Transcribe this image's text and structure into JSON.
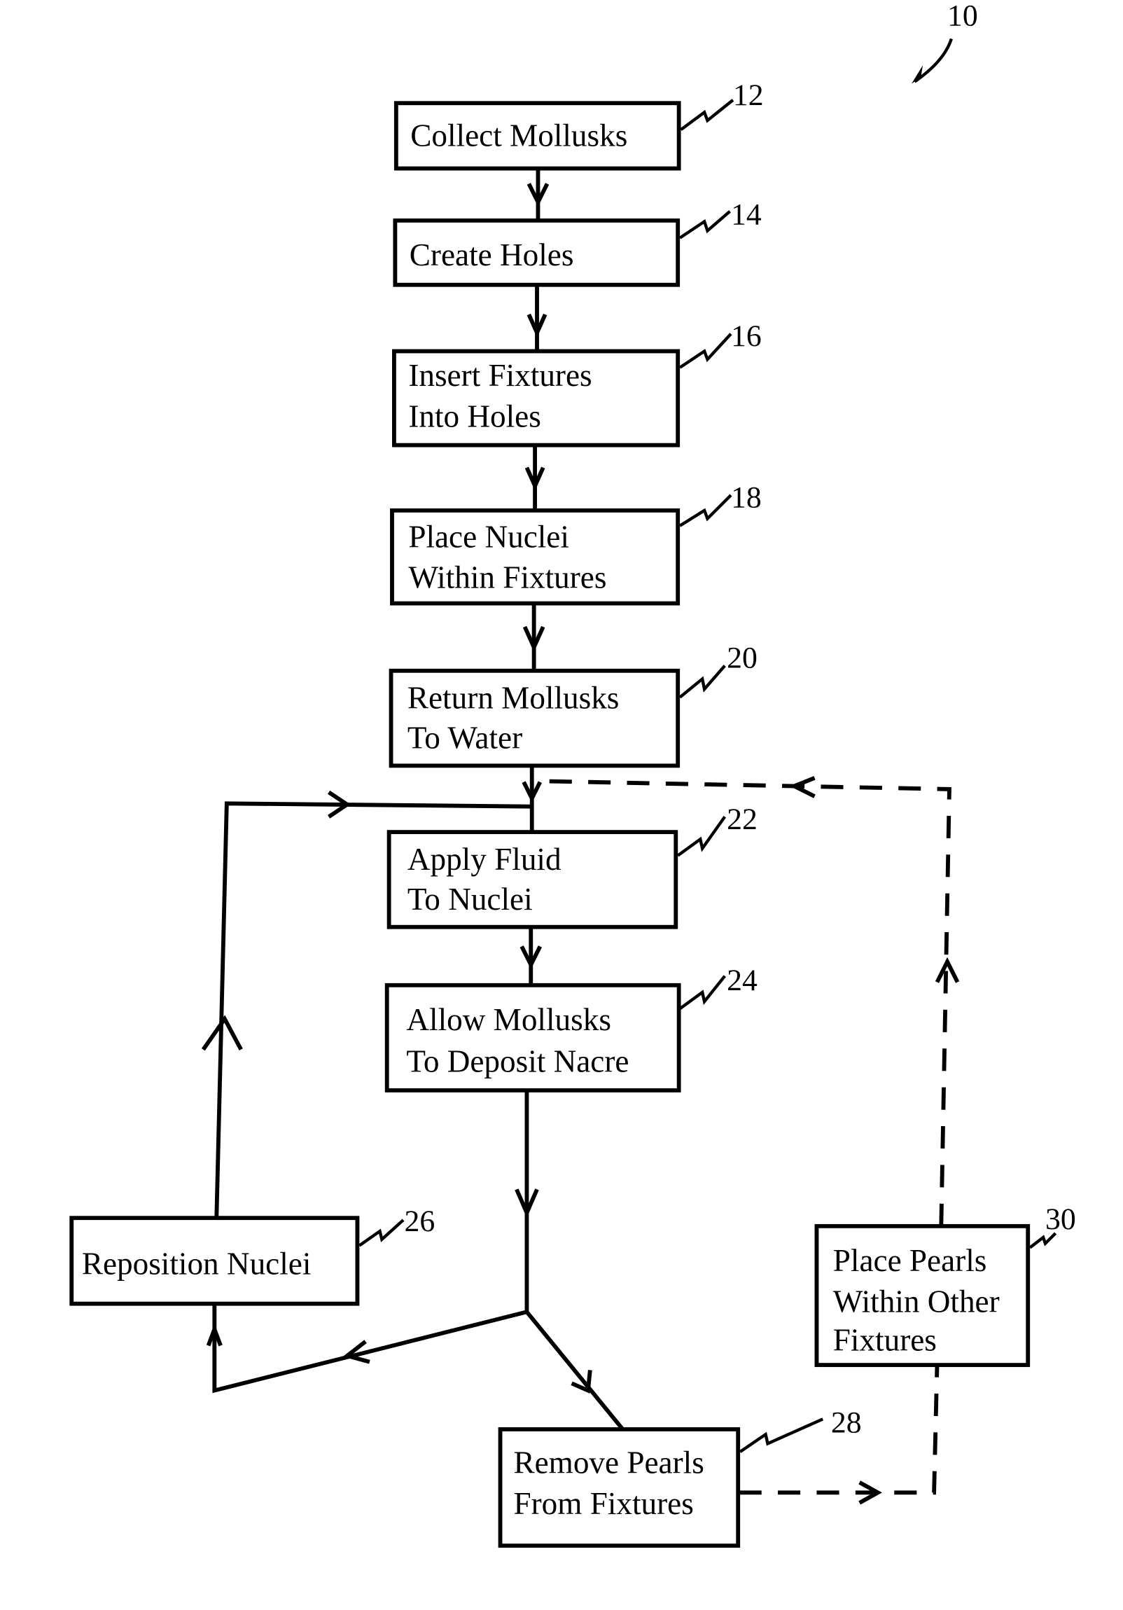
{
  "figure": {
    "reference_numeral": "10",
    "steps": [
      {
        "ref": "12",
        "lines": [
          "Collect Mollusks"
        ]
      },
      {
        "ref": "14",
        "lines": [
          "Create Holes"
        ]
      },
      {
        "ref": "16",
        "lines": [
          "Insert Fixtures",
          "Into Holes"
        ]
      },
      {
        "ref": "18",
        "lines": [
          "Place Nuclei",
          "Within Fixtures"
        ]
      },
      {
        "ref": "20",
        "lines": [
          "Return Mollusks",
          "To Water"
        ]
      },
      {
        "ref": "22",
        "lines": [
          "Apply Fluid",
          "To Nuclei"
        ]
      },
      {
        "ref": "24",
        "lines": [
          "Allow Mollusks",
          "To Deposit Nacre"
        ]
      },
      {
        "ref": "26",
        "lines": [
          "Reposition Nuclei"
        ]
      },
      {
        "ref": "28",
        "lines": [
          "Remove Pearls",
          "From Fixtures"
        ]
      },
      {
        "ref": "30",
        "lines": [
          "Place Pearls",
          "Within Other",
          "Fixtures"
        ]
      }
    ]
  }
}
